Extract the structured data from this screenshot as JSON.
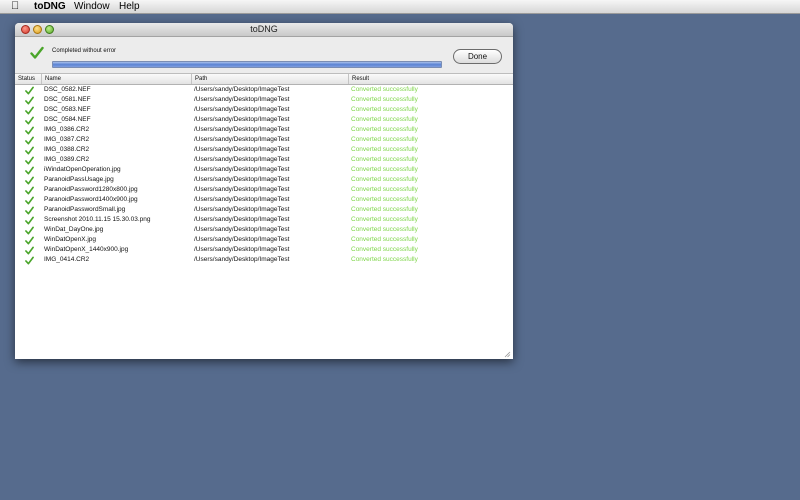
{
  "menubar": {
    "apple_icon": "apple-icon",
    "app_name": "toDNG",
    "items": [
      "Window",
      "Help"
    ]
  },
  "window": {
    "title": "toDNG",
    "status_text": "Completed without error",
    "progress": 1.0,
    "done_label": "Done",
    "columns": [
      "Status",
      "Name",
      "Path",
      "Result"
    ],
    "rows": [
      {
        "status": "check-icon",
        "name": "DSC_0582.NEF",
        "path": "/Users/sandy/Desktop/ImageTest",
        "result": "Converted successfully"
      },
      {
        "status": "check-icon",
        "name": "DSC_0581.NEF",
        "path": "/Users/sandy/Desktop/ImageTest",
        "result": "Converted successfully"
      },
      {
        "status": "check-icon",
        "name": "DSC_0583.NEF",
        "path": "/Users/sandy/Desktop/ImageTest",
        "result": "Converted successfully"
      },
      {
        "status": "check-icon",
        "name": "DSC_0584.NEF",
        "path": "/Users/sandy/Desktop/ImageTest",
        "result": "Converted successfully"
      },
      {
        "status": "check-icon",
        "name": "IMG_0386.CR2",
        "path": "/Users/sandy/Desktop/ImageTest",
        "result": "Converted successfully"
      },
      {
        "status": "check-icon",
        "name": "IMG_0387.CR2",
        "path": "/Users/sandy/Desktop/ImageTest",
        "result": "Converted successfully"
      },
      {
        "status": "check-icon",
        "name": "IMG_0388.CR2",
        "path": "/Users/sandy/Desktop/ImageTest",
        "result": "Converted successfully"
      },
      {
        "status": "check-icon",
        "name": "IMG_0389.CR2",
        "path": "/Users/sandy/Desktop/ImageTest",
        "result": "Converted successfully"
      },
      {
        "status": "check-icon",
        "name": "iWindatOpenOperation.jpg",
        "path": "/Users/sandy/Desktop/ImageTest",
        "result": "Converted successfully"
      },
      {
        "status": "check-icon",
        "name": "ParanoidPassUsage.jpg",
        "path": "/Users/sandy/Desktop/ImageTest",
        "result": "Converted successfully"
      },
      {
        "status": "check-icon",
        "name": "ParanoidPassword1280x800.jpg",
        "path": "/Users/sandy/Desktop/ImageTest",
        "result": "Converted successfully"
      },
      {
        "status": "check-icon",
        "name": "ParanoidPassword1400x900.jpg",
        "path": "/Users/sandy/Desktop/ImageTest",
        "result": "Converted successfully"
      },
      {
        "status": "check-icon",
        "name": "ParanoidPasswordSmall.jpg",
        "path": "/Users/sandy/Desktop/ImageTest",
        "result": "Converted successfully"
      },
      {
        "status": "check-icon",
        "name": "Screenshot 2010.11.15 15.30.03.png",
        "path": "/Users/sandy/Desktop/ImageTest",
        "result": "Converted successfully"
      },
      {
        "status": "check-icon",
        "name": "WinDat_DayOne.jpg",
        "path": "/Users/sandy/Desktop/ImageTest",
        "result": "Converted successfully"
      },
      {
        "status": "check-icon",
        "name": "WinDatOpenX.jpg",
        "path": "/Users/sandy/Desktop/ImageTest",
        "result": "Converted successfully"
      },
      {
        "status": "check-icon",
        "name": "WinDatOpenX_1440x900.jpg",
        "path": "/Users/sandy/Desktop/ImageTest",
        "result": "Converted successfully"
      },
      {
        "status": "check-icon",
        "name": "IMG_0414.CR2",
        "path": "/Users/sandy/Desktop/ImageTest",
        "result": "Converted successfully"
      }
    ]
  },
  "colors": {
    "desktop": "#566b8d",
    "success_text": "#7fd54a",
    "check": "#4aa52a"
  }
}
